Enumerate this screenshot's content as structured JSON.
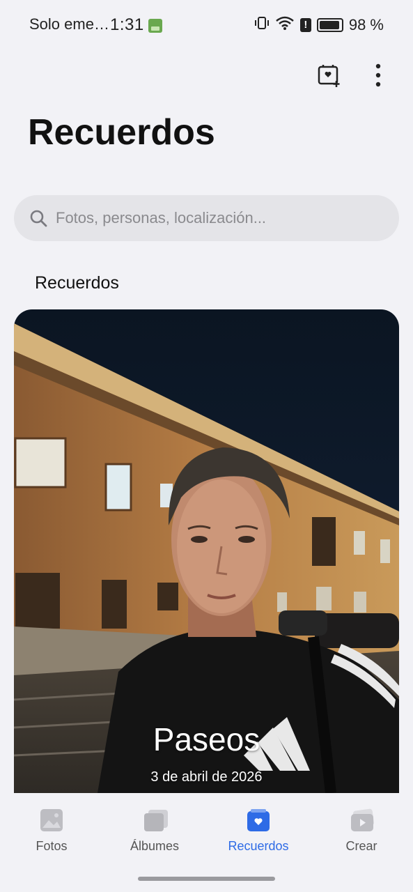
{
  "status_bar": {
    "carrier": "Solo eme…",
    "time": "1:31",
    "battery": "98 %"
  },
  "header": {
    "title": "Recuerdos",
    "actions": [
      {
        "icon": "add-memory-icon"
      },
      {
        "icon": "more-vert-icon"
      }
    ]
  },
  "search": {
    "placeholder": "Fotos, personas, localización..."
  },
  "section": {
    "title": "Recuerdos"
  },
  "memory_card": {
    "title": "Paseos",
    "date": "3 de abril de 2026"
  },
  "bottom_nav": {
    "items": [
      {
        "label": "Fotos",
        "icon": "photos-icon",
        "active": false
      },
      {
        "label": "Álbumes",
        "icon": "albums-icon",
        "active": false
      },
      {
        "label": "Recuerdos",
        "icon": "memories-icon",
        "active": true
      },
      {
        "label": "Crear",
        "icon": "create-icon",
        "active": false
      }
    ]
  },
  "colors": {
    "accent": "#2e6be6",
    "background": "#f2f2f6",
    "search_bg": "#e4e4e8"
  }
}
